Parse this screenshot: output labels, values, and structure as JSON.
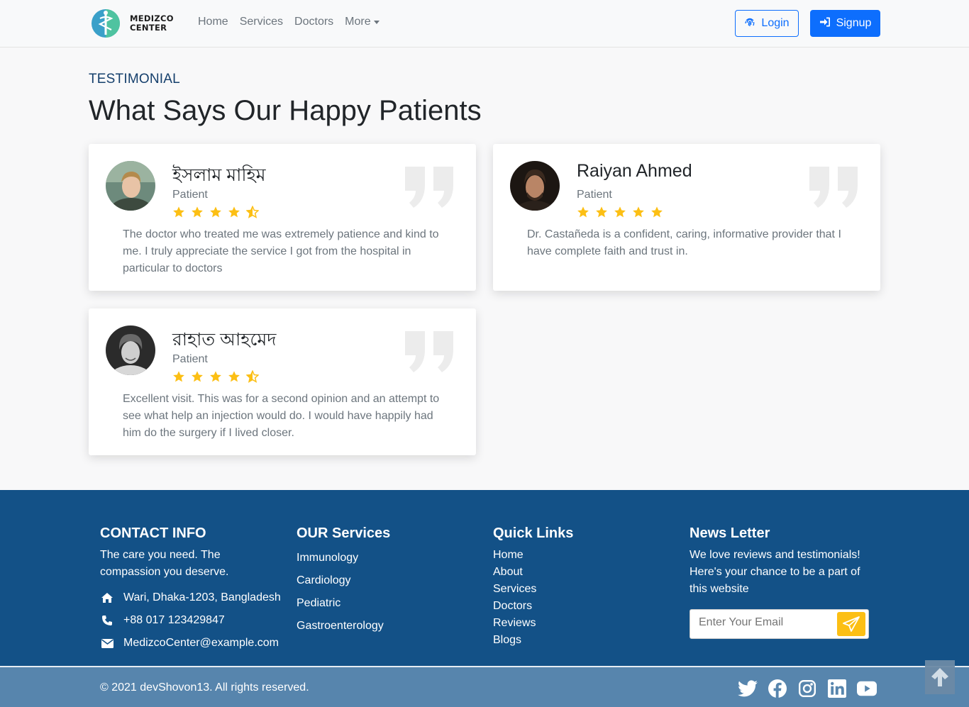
{
  "nav": {
    "logo_line1": "MEDIZCO",
    "logo_line2": "CENTER",
    "links": [
      "Home",
      "Services",
      "Doctors",
      "More"
    ],
    "login": "Login",
    "signup": "Signup"
  },
  "testimonial": {
    "eyebrow": "TESTIMONIAL",
    "title": "What Says Our Happy Patients",
    "cards": [
      {
        "name": "ইসলাম মাহিম",
        "role": "Patient",
        "rating": 4.5,
        "quote": "The doctor who treated me was extremely patience and kind to me. I truly appreciate the service I got from the hospital in particular to doctors"
      },
      {
        "name": "Raiyan Ahmed",
        "role": "Patient",
        "rating": 5,
        "quote": "Dr. Castañeda is a confident, caring, informative provider that I have complete faith and trust in."
      },
      {
        "name": "রাহাত আহমেদ",
        "role": "Patient",
        "rating": 4.5,
        "quote": "Excellent visit. This was for a second opinion and an attempt to see what help an injection would do. I would have happily had him do the surgery if I lived closer."
      }
    ]
  },
  "footer": {
    "contact": {
      "title": "CONTACT INFO",
      "tagline": "The care you need. The compassion you deserve.",
      "address": "Wari, Dhaka-1203, Bangladesh",
      "phone": "+88 017 123429847",
      "email": "MedizcoCenter@example.com"
    },
    "services": {
      "title": "OUR Services",
      "items": [
        "Immunology",
        "Cardiology",
        "Pediatric",
        "Gastroenterology"
      ]
    },
    "quick_links": {
      "title": "Quick Links",
      "items": [
        "Home",
        "About",
        "Services",
        "Doctors",
        "Reviews",
        "Blogs"
      ]
    },
    "newsletter": {
      "title": "News Letter",
      "text": "We love reviews and testimonials! Here's your chance to be a part of this website",
      "placeholder": "Enter Your Email"
    },
    "copyright": "© 2021 devShovon13. All rights reserved.",
    "socials": [
      "twitter-icon",
      "facebook-icon",
      "instagram-icon",
      "linkedin-icon",
      "youtube-icon"
    ]
  },
  "colors": {
    "primary": "#0d6efd",
    "footer": "#135187",
    "star": "#fcbf14"
  }
}
